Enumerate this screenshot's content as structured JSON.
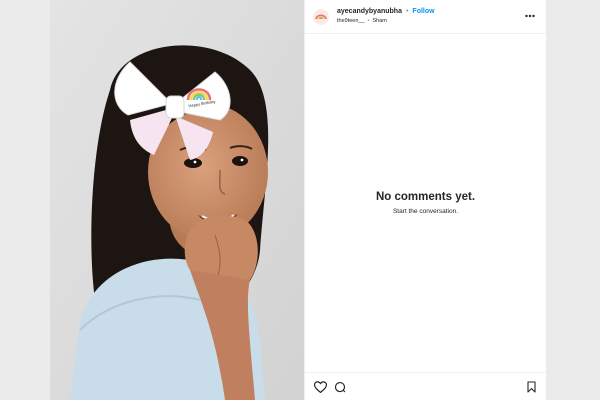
{
  "post": {
    "username": "ayecandybyanubha",
    "follow_label": "Follow",
    "audio_artist": "the9teen__",
    "audio_title": "Sham",
    "comments": {
      "empty_title": "No comments yet.",
      "empty_subtitle": "Start the conversation."
    },
    "bow_text": "Happy Birthday"
  },
  "icons": [
    "more-icon",
    "heart-icon",
    "comment-icon",
    "bookmark-icon"
  ],
  "colors": {
    "follow": "#0095f6",
    "text": "#262626",
    "divider": "#efefef"
  }
}
